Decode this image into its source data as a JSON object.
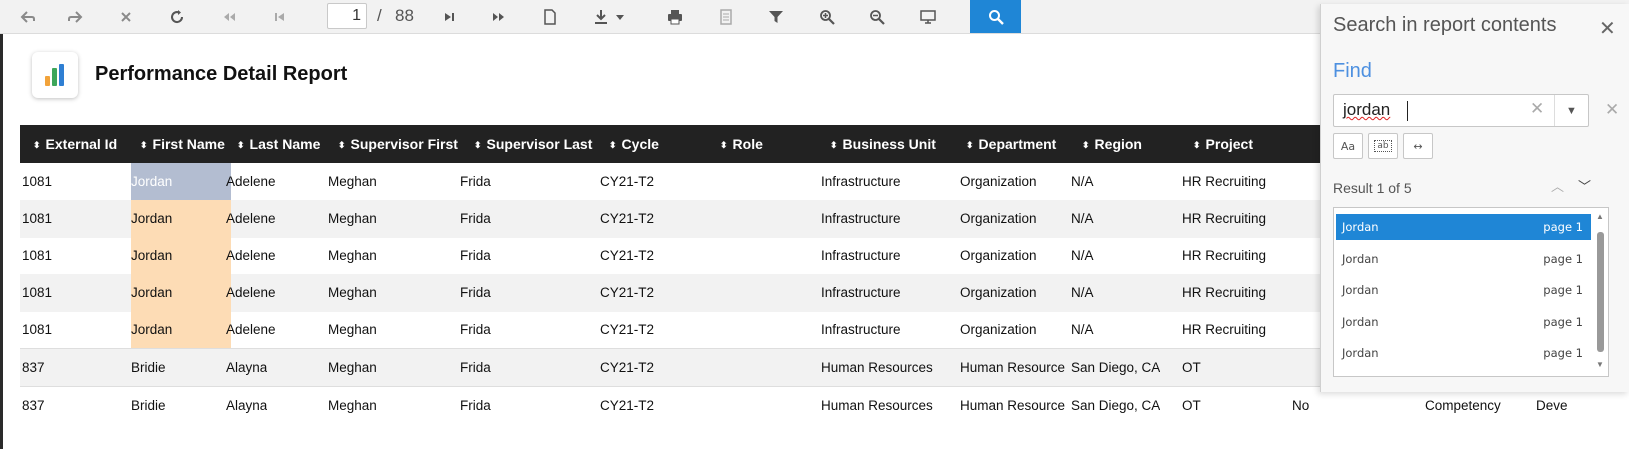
{
  "toolbar": {
    "buttons": [
      {
        "name": "undo",
        "icon": "back-arrow-icon"
      },
      {
        "name": "redo",
        "icon": "forward-arrow-icon"
      },
      {
        "name": "stop",
        "icon": "close-icon"
      },
      {
        "name": "refresh",
        "icon": "refresh-icon"
      },
      {
        "name": "first-page",
        "icon": "double-left-icon"
      },
      {
        "name": "previous-page",
        "icon": "skip-back-icon"
      },
      {
        "name": "next-page",
        "icon": "skip-forward-icon"
      },
      {
        "name": "last-page",
        "icon": "double-right-icon"
      },
      {
        "name": "document",
        "icon": "document-icon"
      },
      {
        "name": "export",
        "icon": "download-icon"
      },
      {
        "name": "print",
        "icon": "printer-icon"
      },
      {
        "name": "print-preview",
        "icon": "print-preview-icon"
      },
      {
        "name": "filter",
        "icon": "filter-icon"
      },
      {
        "name": "zoom-in",
        "icon": "zoom-in-icon"
      },
      {
        "name": "zoom-out",
        "icon": "zoom-out-icon"
      },
      {
        "name": "full-screen",
        "icon": "monitor-icon"
      },
      {
        "name": "search",
        "icon": "search-icon"
      }
    ],
    "current_page": "1",
    "page_separator": "/",
    "total_pages": "88"
  },
  "report": {
    "title": "Performance Detail Report"
  },
  "table": {
    "columns": [
      "External Id",
      "First Name",
      "Last Name",
      "Supervisor First",
      "Supervisor Last",
      "Cycle",
      "Role",
      "Business Unit",
      "Department",
      "Region",
      "Project"
    ],
    "rows": [
      [
        "1081",
        "Jordan",
        "Adelene",
        "Meghan",
        "Frida",
        "CY21-T2",
        "",
        "Infrastructure",
        "Organization",
        "N/A",
        "HR Recruiting",
        "",
        "",
        ""
      ],
      [
        "1081",
        "Jordan",
        "Adelene",
        "Meghan",
        "Frida",
        "CY21-T2",
        "",
        "Infrastructure",
        "Organization",
        "N/A",
        "HR Recruiting",
        "",
        "",
        ""
      ],
      [
        "1081",
        "Jordan",
        "Adelene",
        "Meghan",
        "Frida",
        "CY21-T2",
        "",
        "Infrastructure",
        "Organization",
        "N/A",
        "HR Recruiting",
        "",
        "",
        ""
      ],
      [
        "1081",
        "Jordan",
        "Adelene",
        "Meghan",
        "Frida",
        "CY21-T2",
        "",
        "Infrastructure",
        "Organization",
        "N/A",
        "HR Recruiting",
        "",
        "",
        ""
      ],
      [
        "1081",
        "Jordan",
        "Adelene",
        "Meghan",
        "Frida",
        "CY21-T2",
        "",
        "Infrastructure",
        "Organization",
        "N/A",
        "HR Recruiting",
        "",
        "",
        ""
      ],
      [
        "837",
        "Bridie",
        "Alayna",
        "Meghan",
        "Frida",
        "CY21-T2",
        "",
        "Human Resources",
        "Human Resource",
        "San Diego, CA",
        "OT",
        "",
        "",
        ""
      ],
      [
        "837",
        "Bridie",
        "Alayna",
        "Meghan",
        "Frida",
        "CY21-T2",
        "",
        "Human Resources",
        "Human Resource",
        "San Diego, CA",
        "OT",
        "No",
        "Competency",
        "Deve"
      ]
    ]
  },
  "search_panel": {
    "title": "Search in report contents",
    "find_label": "Find",
    "query": "jordan",
    "options": [
      "Aa",
      "ab",
      "↔"
    ],
    "result_summary": "Result 1 of 5",
    "results": [
      {
        "name": "Jordan",
        "page": "page 1"
      },
      {
        "name": "Jordan",
        "page": "page 1"
      },
      {
        "name": "Jordan",
        "page": "page 1"
      },
      {
        "name": "Jordan",
        "page": "page 1"
      },
      {
        "name": "Jordan",
        "page": "page 1"
      }
    ]
  },
  "colors": {
    "accent": "#1f86d6",
    "header_bg": "#222222",
    "match_highlight": "#fddcb5",
    "current_match_highlight": "#b3bdd1",
    "find_label": "#4d90e0"
  }
}
